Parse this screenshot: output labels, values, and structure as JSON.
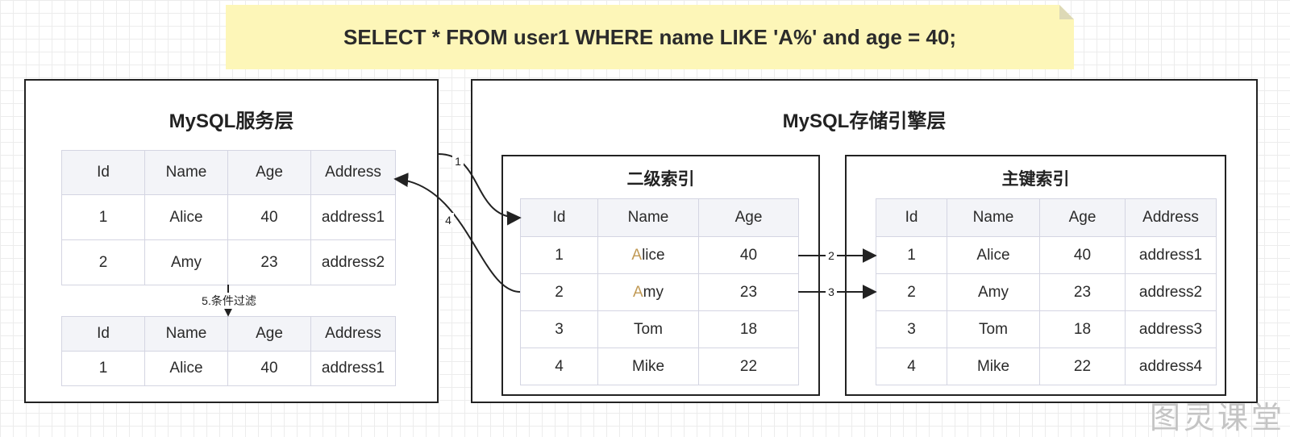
{
  "sql": "SELECT * FROM user1 WHERE name LIKE 'A%' and age = 40;",
  "server_layer": {
    "title": "MySQL服务层",
    "columns": [
      "Id",
      "Name",
      "Age",
      "Address"
    ],
    "table_before": [
      [
        "1",
        "Alice",
        "40",
        "address1"
      ],
      [
        "2",
        "Amy",
        "23",
        "address2"
      ]
    ],
    "filter_label": "5.条件过滤",
    "table_after": [
      [
        "1",
        "Alice",
        "40",
        "address1"
      ]
    ]
  },
  "storage_layer": {
    "title": "MySQL存储引擎层",
    "secondary_index": {
      "title": "二级索引",
      "columns": [
        "Id",
        "Name",
        "Age"
      ],
      "rows": [
        [
          "1",
          "Alice",
          "40"
        ],
        [
          "2",
          "Amy",
          "23"
        ],
        [
          "3",
          "Tom",
          "18"
        ],
        [
          "4",
          "Mike",
          "22"
        ]
      ]
    },
    "primary_index": {
      "title": "主键索引",
      "columns": [
        "Id",
        "Name",
        "Age",
        "Address"
      ],
      "rows": [
        [
          "1",
          "Alice",
          "40",
          "address1"
        ],
        [
          "2",
          "Amy",
          "23",
          "address2"
        ],
        [
          "3",
          "Tom",
          "18",
          "address3"
        ],
        [
          "4",
          "Mike",
          "22",
          "address4"
        ]
      ]
    }
  },
  "edges": [
    {
      "id": "edge-1",
      "label": "1"
    },
    {
      "id": "edge-2",
      "label": "2"
    },
    {
      "id": "edge-3",
      "label": "3"
    },
    {
      "id": "edge-4",
      "label": "4"
    }
  ],
  "watermark": "图灵课堂",
  "colors": {
    "note_bg": "#fdf6b8",
    "header_bg": "#f3f4f8",
    "cell_border": "#d4d5e2",
    "highlight_letter": "#c19a55",
    "stroke": "#222222"
  }
}
